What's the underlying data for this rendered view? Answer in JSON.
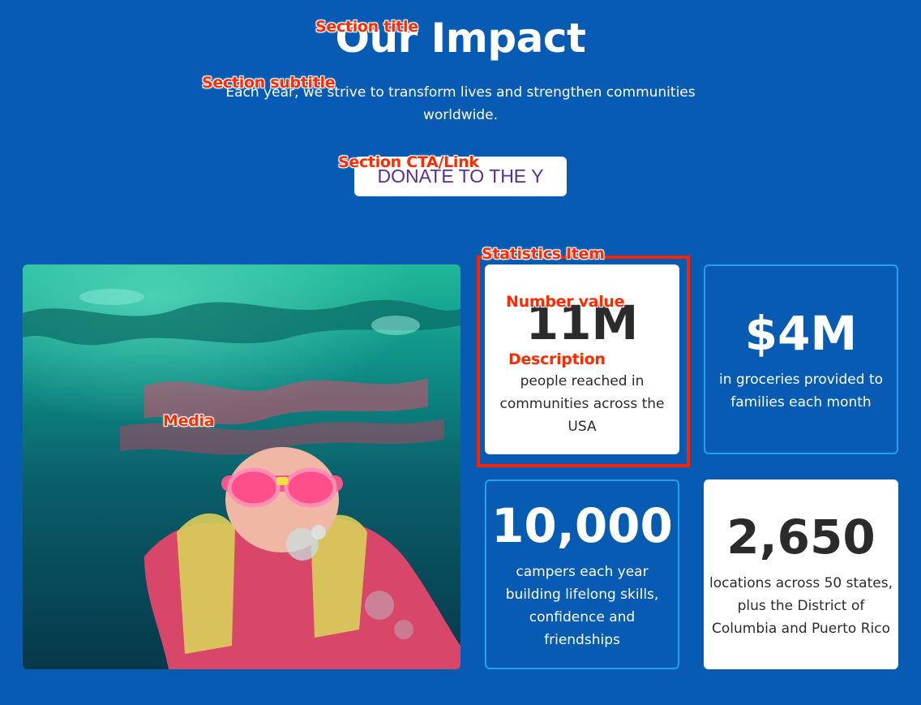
{
  "section": {
    "title": "Our Impact",
    "subtitle": "Each year, we strive to transform lives and strengthen communities worldwide.",
    "cta_label": "DONATE TO THE Y"
  },
  "stats": [
    {
      "value": "11M",
      "description": "people reached in communities across the USA"
    },
    {
      "value": "$4M",
      "description": "in groceries provided to families each month"
    },
    {
      "value": "10,000",
      "description": "campers each year building lifelong skills, confidence and friendships"
    },
    {
      "value": "2,650",
      "description": "locations across 50 states, plus the District of Columbia and Puerto Rico"
    }
  ],
  "annotations": {
    "section_title": "Section title",
    "section_subtitle": "Section subtitle",
    "section_cta": "Section CTA/Link",
    "statistics_item": "Statistics Item",
    "number_value": "Number value",
    "description": "Description",
    "media": "Media"
  },
  "colors": {
    "background": "#075bb3",
    "card_light": "#ffffff",
    "card_border": "#21a0f0",
    "cta_text": "#5a2c91",
    "annotation": "#ff2a00"
  }
}
